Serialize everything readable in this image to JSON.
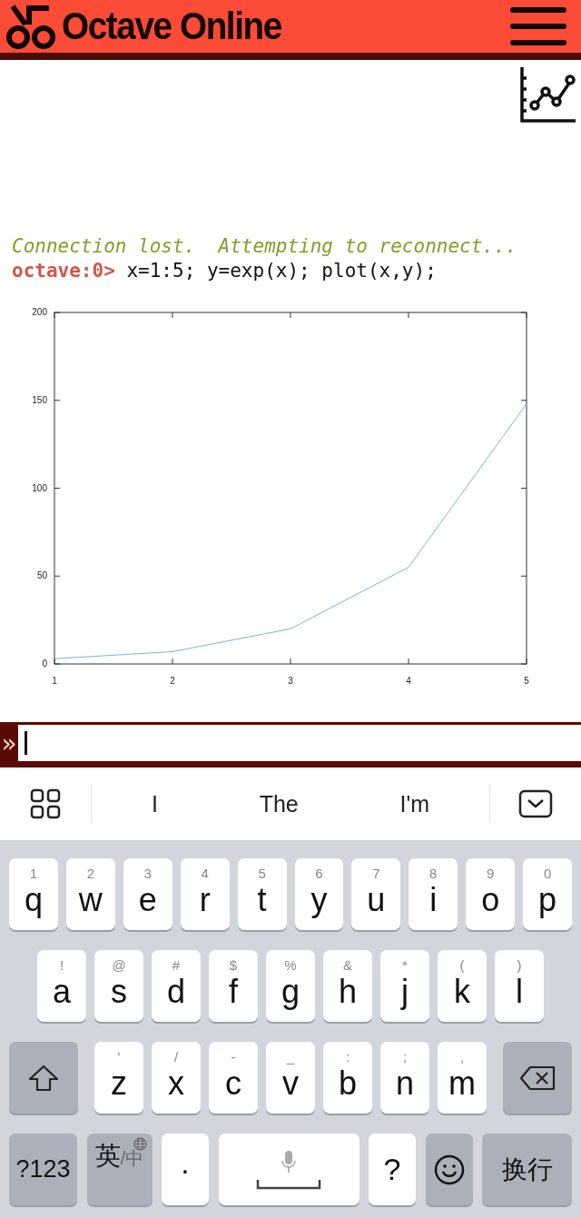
{
  "header": {
    "title": "Octave Online"
  },
  "console": {
    "lines": [
      {
        "kind": "status",
        "text": "Connection lost.  Attempting to reconnect..."
      },
      {
        "kind": "command",
        "prompt": "octave:0>",
        "text": "x=1:5; y=exp(x); plot(x,y);"
      }
    ]
  },
  "plot": {
    "chart_data": {
      "type": "line",
      "x": [
        1,
        2,
        3,
        4,
        5
      ],
      "series": [
        {
          "color": "#7fb2cf",
          "values": [
            3,
            7,
            20,
            55,
            148
          ]
        }
      ],
      "xlim": [
        1,
        5
      ],
      "ylim": [
        0,
        200
      ],
      "xticks": [
        1,
        2,
        3,
        4,
        5
      ],
      "yticks": [
        0,
        50,
        100,
        150,
        200
      ]
    }
  },
  "input": {
    "prompt": "»"
  },
  "suggestions": [
    "I",
    "The",
    "I'm"
  ],
  "keyboard": {
    "rows": [
      [
        {
          "kind": "letter",
          "hint": "1",
          "label": "q"
        },
        {
          "kind": "letter",
          "hint": "2",
          "label": "w"
        },
        {
          "kind": "letter",
          "hint": "3",
          "label": "e"
        },
        {
          "kind": "letter",
          "hint": "4",
          "label": "r"
        },
        {
          "kind": "letter",
          "hint": "5",
          "label": "t"
        },
        {
          "kind": "letter",
          "hint": "6",
          "label": "y"
        },
        {
          "kind": "letter",
          "hint": "7",
          "label": "u"
        },
        {
          "kind": "letter",
          "hint": "8",
          "label": "i"
        },
        {
          "kind": "letter",
          "hint": "9",
          "label": "o"
        },
        {
          "kind": "letter",
          "hint": "0",
          "label": "p"
        }
      ],
      [
        {
          "kind": "letter",
          "hint": "!",
          "label": "a"
        },
        {
          "kind": "letter",
          "hint": "@",
          "label": "s"
        },
        {
          "kind": "letter",
          "hint": "#",
          "label": "d"
        },
        {
          "kind": "letter",
          "hint": "$",
          "label": "f"
        },
        {
          "kind": "letter",
          "hint": "%",
          "label": "g"
        },
        {
          "kind": "letter",
          "hint": "&",
          "label": "h"
        },
        {
          "kind": "letter",
          "hint": "*",
          "label": "j"
        },
        {
          "kind": "letter",
          "hint": "(",
          "label": "k"
        },
        {
          "kind": "letter",
          "hint": ")",
          "label": "l"
        }
      ],
      [
        {
          "kind": "shift"
        },
        {
          "kind": "letter",
          "hint": "'",
          "label": "z"
        },
        {
          "kind": "letter",
          "hint": "/",
          "label": "x"
        },
        {
          "kind": "letter",
          "hint": "-",
          "label": "c"
        },
        {
          "kind": "letter",
          "hint": "_",
          "label": "v"
        },
        {
          "kind": "letter",
          "hint": ":",
          "label": "b"
        },
        {
          "kind": "letter",
          "hint": ";",
          "label": "n"
        },
        {
          "kind": "letter",
          "hint": ",",
          "label": "m"
        },
        {
          "kind": "backspace"
        }
      ]
    ],
    "bottom_row": [
      {
        "kind": "function",
        "label": "?123"
      },
      {
        "kind": "language",
        "label": "英",
        "sub": "/中"
      },
      {
        "kind": "symbol",
        "label": "·"
      },
      {
        "kind": "space"
      },
      {
        "kind": "symbol",
        "label": "?"
      },
      {
        "kind": "emoji"
      },
      {
        "kind": "enter",
        "label": "换行"
      }
    ]
  }
}
